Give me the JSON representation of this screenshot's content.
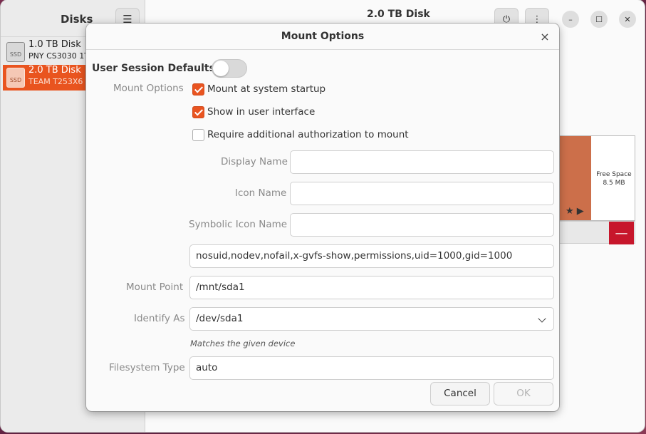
{
  "background_window": {
    "sidebar_title": "Disks",
    "menu_icon": "hamburger-menu-icon",
    "disks": [
      {
        "name": "1.0 TB Disk",
        "model": "PNY CS3030 1T",
        "icon_label": "SSD"
      },
      {
        "name": "2.0 TB Disk",
        "model": "TEAM T253X6",
        "icon_label": "SSD"
      }
    ],
    "title": "2.0 TB Disk",
    "power_icon": "power-icon",
    "more_icon": "more-options-icon",
    "partition": {
      "free_space_label": "Free Space",
      "free_space_size": "8.5 MB",
      "icons": "★ ▶",
      "delete_label": "—"
    },
    "window_controls": {
      "minimize": "–",
      "maximize": "☐",
      "close": "✕"
    }
  },
  "dialog": {
    "title": "Mount Options",
    "close_glyph": "×",
    "user_session_defaults": {
      "label": "User Session Defaults",
      "enabled": false
    },
    "mount_options_label": "Mount Options",
    "checkboxes": [
      {
        "label": "Mount at system startup",
        "checked": true
      },
      {
        "label": "Show in user interface",
        "checked": true
      },
      {
        "label": "Require additional authorization to mount",
        "checked": false
      }
    ],
    "display_name": {
      "label": "Display Name",
      "value": ""
    },
    "icon_name": {
      "label": "Icon Name",
      "value": ""
    },
    "symbolic_icon_name": {
      "label": "Symbolic Icon Name",
      "value": ""
    },
    "options_field": {
      "value": "nosuid,nodev,nofail,x-gvfs-show,permissions,uid=1000,gid=1000"
    },
    "mount_point": {
      "label": "Mount Point",
      "value": "/mnt/sda1"
    },
    "identify_as": {
      "label": "Identify As",
      "value": "/dev/sda1",
      "hint": "Matches the given device"
    },
    "filesystem_type": {
      "label": "Filesystem Type",
      "value": "auto"
    },
    "buttons": {
      "cancel": "Cancel",
      "ok": "OK"
    },
    "colors": {
      "accent": "#e95420",
      "selection": "#e9541f",
      "destructive": "#c7162b"
    }
  }
}
